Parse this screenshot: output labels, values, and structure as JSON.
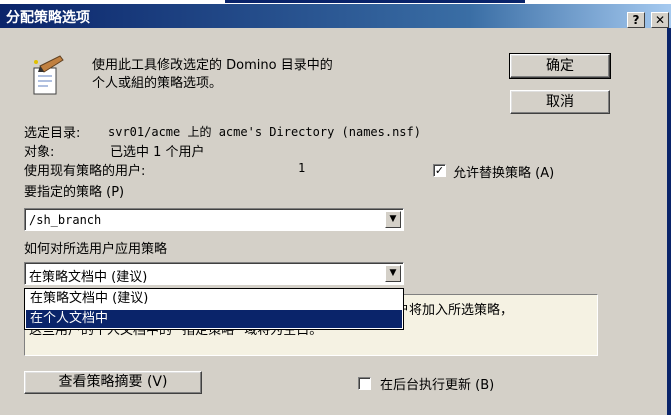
{
  "window": {
    "title": "分配策略选项",
    "help_glyph": "?",
    "close_glyph": "✕"
  },
  "intro": {
    "line1": "使用此工具修改选定的 Domino 目录中的",
    "line2": "个人或組的策略选项。"
  },
  "buttons": {
    "ok": "确定",
    "cancel": "取消",
    "view_summary": "查看策略摘要 (V)"
  },
  "info": {
    "directory_label": "选定目录:",
    "directory_value": "svr01/acme 上的 acme's Directory (names.nsf)",
    "object_label": "对象:",
    "object_value": "已选中 1 个用户",
    "existing_users_label": "使用现有策略的用户:",
    "existing_users_count": "1"
  },
  "allow_replace": {
    "label": "允许替换策略 (A)",
    "checked": true,
    "mark": "✓"
  },
  "policy": {
    "label": "要指定的策略 (P)",
    "value": "/sh_branch"
  },
  "apply_method": {
    "label": "如何对所选用户应用策略",
    "value": "在策略文档中 (建议)",
    "options": [
      "在策略文档中 (建议)",
      "在个人文档中"
    ],
    "selected_index": 1
  },
  "description": {
    "line1_visible": "用户将加入所选策略，",
    "line2_visible": "这些用户的个人文档中的 \"指定策略\" 域将为空白。"
  },
  "background_update": {
    "label": "在后台执行更新 (B)",
    "checked": false
  },
  "icons": {
    "dropdown_arrow": "▼"
  },
  "colors": {
    "titlebar_start": "#0a246a",
    "titlebar_end": "#a6caf0",
    "dialog_bg": "#d4d0c8",
    "selection": "#0a246a",
    "info_panel_bg": "#f5f2e3"
  }
}
